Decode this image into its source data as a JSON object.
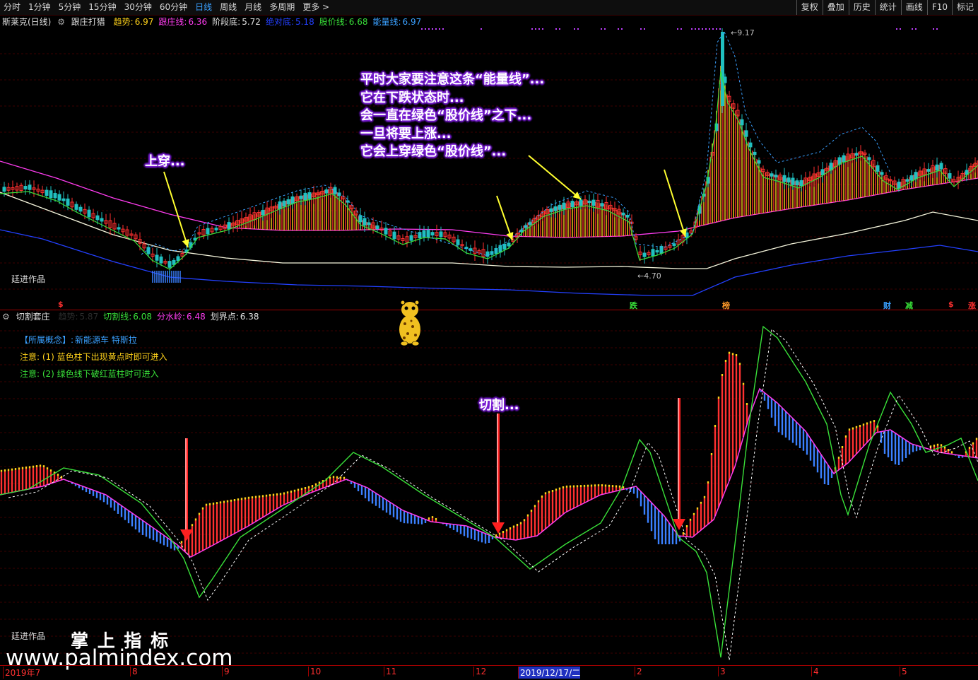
{
  "toolbar": {
    "tabs": [
      "分时",
      "1分钟",
      "5分钟",
      "15分钟",
      "30分钟",
      "60分钟",
      "日线",
      "周线",
      "月线",
      "多周期",
      "更多 >"
    ],
    "active_tab": "日线",
    "right_buttons": [
      "复权",
      "叠加",
      "历史",
      "统计",
      "画线",
      "F10",
      "标记"
    ]
  },
  "main_panel": {
    "title": "斯莱克(日线)",
    "indicator": "跟庄打猎",
    "readouts": [
      {
        "label": "趋势:",
        "value": "6.97",
        "color": "#ffd21a"
      },
      {
        "label": "跟庄线:",
        "value": "6.36",
        "color": "#ff3cf0"
      },
      {
        "label": "阶段底:",
        "value": "5.72",
        "color": "#e0e0e0"
      },
      {
        "label": "绝对底:",
        "value": "5.18",
        "color": "#2340ff"
      },
      {
        "label": "股价线:",
        "value": "6.68",
        "color": "#39e039"
      },
      {
        "label": "能量线:",
        "value": "6.97",
        "color": "#3aa0ff"
      }
    ],
    "high_label": "9.17",
    "low_label": "4.70",
    "author": "廷进作品",
    "bottom_markers": [
      {
        "text": "$",
        "color": "#ff3030"
      },
      {
        "text": "跌",
        "color": "#39e039"
      },
      {
        "text": "榜",
        "color": "#ff9a2a"
      },
      {
        "text": "财",
        "color": "#3aa0ff"
      },
      {
        "text": "减",
        "color": "#39e039"
      },
      {
        "text": "$",
        "color": "#ff3030"
      },
      {
        "text": "涨",
        "color": "#ff3030"
      }
    ]
  },
  "sub_panel": {
    "indicator": "切割套庄",
    "readouts": [
      {
        "label": "趋势:",
        "value": "5.87",
        "color": "#2b2b2b"
      },
      {
        "label": "切割线:",
        "value": "6.08",
        "color": "#39e039"
      },
      {
        "label": "分水岭:",
        "value": "6.48",
        "color": "#ff3cf0"
      },
      {
        "label": "划界点:",
        "value": "6.38",
        "color": "#e0e0e0"
      }
    ],
    "concept_label": "【所属概念】:",
    "concept_value": "新能源车 特斯拉",
    "note1": "注意: (1) 蓝色柱下出现黄点时即可进入",
    "note2": "注意: (2) 绿色线下破红蓝柱时可进入",
    "author": "廷进作品"
  },
  "annotations": {
    "shangchuan": "上穿...",
    "energy_lines": [
      "平时大家要注意这条“能量线”...",
      "它在下跌状态时...",
      "会一直在绿色“股价线”之下...",
      "一旦将要上涨...",
      "它会上穿绿色“股价线”..."
    ],
    "qiege": "切割..."
  },
  "watermark": {
    "cn": "掌 上 指 标",
    "url": "www.palmindex.com"
  },
  "time_axis": {
    "labels": [
      "2019年7",
      "8",
      "9",
      "10",
      "11",
      "12",
      "2019/12/17/二",
      "2",
      "3",
      "4",
      "5"
    ],
    "highlight": "2019/12/17/二"
  },
  "chart_data": [
    {
      "type": "candlestick",
      "title": "斯莱克(日线)",
      "indicator": "跟庄打猎",
      "x": "2019-07 .. 2020-05 (daily)",
      "price_range": [
        4.7,
        9.17
      ],
      "labeled_points": [
        {
          "label": "high",
          "value": 9.17
        },
        {
          "label": "low",
          "value": 4.7
        }
      ],
      "series": [
        {
          "name": "趋势",
          "last": 6.97
        },
        {
          "name": "跟庄线",
          "last": 6.36
        },
        {
          "name": "阶段底",
          "last": 5.72
        },
        {
          "name": "绝对底",
          "last": 5.18
        },
        {
          "name": "股价线",
          "last": 6.68
        },
        {
          "name": "能量线",
          "last": 6.97
        }
      ]
    },
    {
      "type": "bar",
      "indicator": "切割套庄",
      "series": [
        {
          "name": "趋势",
          "last": 5.87
        },
        {
          "name": "切割线",
          "last": 6.08
        },
        {
          "name": "分水岭",
          "last": 6.48
        },
        {
          "name": "划界点",
          "last": 6.38
        }
      ]
    }
  ],
  "colors": {
    "up": "#ff3030",
    "down": "#20c0c0",
    "accent_purple": "#7b1fd6",
    "grid_red": "#8a0000"
  }
}
